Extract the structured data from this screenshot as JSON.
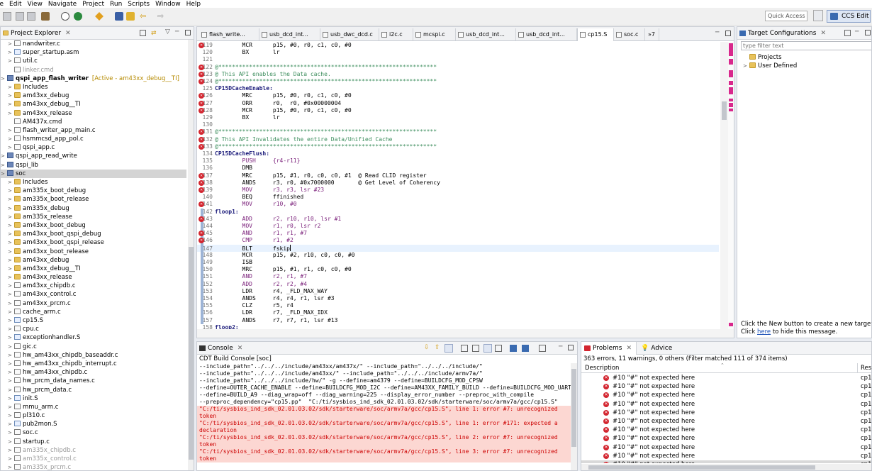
{
  "menu": [
    "le",
    "Edit",
    "View",
    "Navigate",
    "Project",
    "Run",
    "Scripts",
    "Window",
    "Help"
  ],
  "toolbar": {
    "quick_access": "Quick Access",
    "perspective": "CCS Edit"
  },
  "project_explorer": {
    "title": "Project Explorer",
    "items": [
      {
        "label": "nandwriter.c",
        "icon": "c-file-icon",
        "indent": 1,
        "arrow": true
      },
      {
        "label": "super_startup.asm",
        "icon": "asm-file-icon",
        "indent": 1,
        "arrow": true
      },
      {
        "label": "util.c",
        "icon": "c-file-icon",
        "indent": 1,
        "arrow": true
      },
      {
        "label": "linker.cmd",
        "icon": "cmd-file-icon",
        "indent": 1,
        "arrow": false,
        "dim": true
      },
      {
        "label": "qspi_app_flash_writer",
        "suffix": "[Active - am43xx_debug__TI]",
        "icon": "project-icon",
        "indent": 0,
        "arrow": true,
        "bold": true
      },
      {
        "label": "Includes",
        "icon": "folder-icon",
        "indent": 1,
        "arrow": true
      },
      {
        "label": "am43xx_debug",
        "icon": "folder-icon",
        "indent": 1,
        "arrow": true
      },
      {
        "label": "am43xx_debug__TI",
        "icon": "folder-icon",
        "indent": 1,
        "arrow": true
      },
      {
        "label": "am43xx_release",
        "icon": "folder-icon",
        "indent": 1,
        "arrow": true
      },
      {
        "label": "AM437x.cmd",
        "icon": "cmd-file-icon",
        "indent": 1,
        "arrow": false
      },
      {
        "label": "flash_writer_app_main.c",
        "icon": "c-file-icon",
        "indent": 1,
        "arrow": true
      },
      {
        "label": "hsmmcsd_app_pol.c",
        "icon": "c-file-icon",
        "indent": 1,
        "arrow": true
      },
      {
        "label": "qspi_app.c",
        "icon": "c-file-icon",
        "indent": 1,
        "arrow": true
      },
      {
        "label": "qspi_app_read_write",
        "icon": "project-icon",
        "indent": 0,
        "arrow": true
      },
      {
        "label": "qspi_lib",
        "icon": "project-icon",
        "indent": 0,
        "arrow": true
      },
      {
        "label": "soc",
        "icon": "project-icon",
        "indent": 0,
        "arrow": true,
        "selected": true
      },
      {
        "label": "Includes",
        "icon": "folder-icon",
        "indent": 1,
        "arrow": true
      },
      {
        "label": "am335x_boot_debug",
        "icon": "folder-icon",
        "indent": 1,
        "arrow": true
      },
      {
        "label": "am335x_boot_release",
        "icon": "folder-icon",
        "indent": 1,
        "arrow": true
      },
      {
        "label": "am335x_debug",
        "icon": "folder-icon",
        "indent": 1,
        "arrow": true
      },
      {
        "label": "am335x_release",
        "icon": "folder-icon",
        "indent": 1,
        "arrow": true
      },
      {
        "label": "am43xx_boot_debug",
        "icon": "folder-icon",
        "indent": 1,
        "arrow": true
      },
      {
        "label": "am43xx_boot_qspi_debug",
        "icon": "folder-icon",
        "indent": 1,
        "arrow": true
      },
      {
        "label": "am43xx_boot_qspi_release",
        "icon": "folder-icon",
        "indent": 1,
        "arrow": true
      },
      {
        "label": "am43xx_boot_release",
        "icon": "folder-icon",
        "indent": 1,
        "arrow": true
      },
      {
        "label": "am43xx_debug",
        "icon": "folder-icon",
        "indent": 1,
        "arrow": true
      },
      {
        "label": "am43xx_debug__TI",
        "icon": "folder-icon",
        "indent": 1,
        "arrow": true
      },
      {
        "label": "am43xx_release",
        "icon": "folder-icon",
        "indent": 1,
        "arrow": true
      },
      {
        "label": "am43xx_chipdb.c",
        "icon": "c-file-icon",
        "indent": 1,
        "arrow": true
      },
      {
        "label": "am43xx_control.c",
        "icon": "c-file-icon",
        "indent": 1,
        "arrow": true
      },
      {
        "label": "am43xx_prcm.c",
        "icon": "c-file-icon",
        "indent": 1,
        "arrow": true
      },
      {
        "label": "cache_arm.c",
        "icon": "c-file-icon",
        "indent": 1,
        "arrow": true
      },
      {
        "label": "cp15.S",
        "icon": "asm-file-icon",
        "indent": 1,
        "arrow": true
      },
      {
        "label": "cpu.c",
        "icon": "c-file-icon",
        "indent": 1,
        "arrow": true
      },
      {
        "label": "exceptionhandler.S",
        "icon": "asm-file-icon",
        "indent": 1,
        "arrow": true
      },
      {
        "label": "gic.c",
        "icon": "c-file-icon",
        "indent": 1,
        "arrow": true
      },
      {
        "label": "hw_am43xx_chipdb_baseaddr.c",
        "icon": "c-file-icon",
        "indent": 1,
        "arrow": true
      },
      {
        "label": "hw_am43xx_chipdb_interrupt.c",
        "icon": "c-file-icon",
        "indent": 1,
        "arrow": true
      },
      {
        "label": "hw_am43xx_chipdb.c",
        "icon": "c-file-icon",
        "indent": 1,
        "arrow": true
      },
      {
        "label": "hw_prcm_data_names.c",
        "icon": "c-file-icon",
        "indent": 1,
        "arrow": true
      },
      {
        "label": "hw_prcm_data.c",
        "icon": "c-file-icon",
        "indent": 1,
        "arrow": true
      },
      {
        "label": "init.S",
        "icon": "asm-file-icon",
        "indent": 1,
        "arrow": true
      },
      {
        "label": "mmu_arm.c",
        "icon": "c-file-icon",
        "indent": 1,
        "arrow": true
      },
      {
        "label": "pl310.c",
        "icon": "c-file-icon",
        "indent": 1,
        "arrow": true
      },
      {
        "label": "pub2mon.S",
        "icon": "asm-file-icon",
        "indent": 1,
        "arrow": true
      },
      {
        "label": "soc.c",
        "icon": "c-file-icon",
        "indent": 1,
        "arrow": true
      },
      {
        "label": "startup.c",
        "icon": "c-file-icon",
        "indent": 1,
        "arrow": true
      },
      {
        "label": "am335x_chipdb.c",
        "icon": "c-file-icon",
        "indent": 1,
        "arrow": true,
        "dim": true
      },
      {
        "label": "am335x_control.c",
        "icon": "c-file-icon",
        "indent": 1,
        "arrow": true,
        "dim": true
      },
      {
        "label": "am335x_prcm.c",
        "icon": "c-file-icon",
        "indent": 1,
        "arrow": true,
        "dim": true
      }
    ]
  },
  "editor": {
    "tabs": [
      "flash_write...",
      "usb_dcd_int...",
      "usb_dwc_dcd.c",
      "i2c.c",
      "mcspi.c",
      "usb_dcd_int...",
      "usb_dcd_int...",
      "cp15.S",
      "soc.c",
      "»7"
    ],
    "active_tab": 7,
    "lines": [
      {
        "n": "119",
        "err": true,
        "text": "        MCR      p15, #0, r0, c1, c0, #0"
      },
      {
        "n": "120",
        "err": false,
        "text": "        BX       lr"
      },
      {
        "n": "121",
        "err": false,
        "text": ""
      },
      {
        "n": "122",
        "err": true,
        "text": "@****************************************************************",
        "cm": true
      },
      {
        "n": "123",
        "err": true,
        "text": "@ This API enables the Data cache.",
        "cm": true
      },
      {
        "n": "124",
        "err": true,
        "text": "@****************************************************************",
        "cm": true
      },
      {
        "n": "125",
        "err": false,
        "text": "CP15DCacheEnable:",
        "label": true
      },
      {
        "n": "126",
        "err": true,
        "text": "        MRC      p15, #0, r0, c1, c0, #0"
      },
      {
        "n": "127",
        "err": true,
        "text": "        ORR      r0,  r0, #0x00000004"
      },
      {
        "n": "128",
        "err": true,
        "text": "        MCR      p15, #0, r0, c1, c0, #0"
      },
      {
        "n": "129",
        "err": false,
        "text": "        BX       lr"
      },
      {
        "n": "130",
        "err": false,
        "text": ""
      },
      {
        "n": "131",
        "err": true,
        "text": "@****************************************************************",
        "cm": true
      },
      {
        "n": "132",
        "err": true,
        "text": "@ This API Invalidates the entire Data/Unified Cache",
        "cm": true
      },
      {
        "n": "133",
        "err": true,
        "text": "@****************************************************************",
        "cm": true
      },
      {
        "n": "134",
        "err": false,
        "text": "CP15DCacheFlush:",
        "label": true
      },
      {
        "n": "135",
        "err": false,
        "text": "        PUSH     {r4-r11}",
        "kw": true
      },
      {
        "n": "136",
        "err": false,
        "text": "        DMB"
      },
      {
        "n": "137",
        "err": true,
        "text": "        MRC      p15, #1, r0, c0, c0, #1  @ Read CLID register"
      },
      {
        "n": "138",
        "err": true,
        "text": "        ANDS     r3, r0, #0x7000000       @ Get Level of Coherency"
      },
      {
        "n": "139",
        "err": true,
        "text": "        MOV      r3, r3, lsr #23",
        "kw": true
      },
      {
        "n": "140",
        "err": false,
        "text": "        BEQ      ffinished"
      },
      {
        "n": "141",
        "err": true,
        "text": "        MOV      r10, #0",
        "kw": true
      },
      {
        "n": "142",
        "err": false,
        "text": "floop1:",
        "label": true
      },
      {
        "n": "143",
        "err": true,
        "text": "        ADD      r2, r10, r10, lsr #1",
        "kw": true
      },
      {
        "n": "144",
        "err": false,
        "text": "        MOV      r1, r0, lsr r2",
        "kw": true
      },
      {
        "n": "145",
        "err": true,
        "text": "        AND      r1, r1, #7",
        "kw": true
      },
      {
        "n": "146",
        "err": true,
        "text": "        CMP      r1, #2",
        "kw": true
      },
      {
        "n": "147",
        "err": false,
        "text": "        BLT      fskip",
        "cur": true
      },
      {
        "n": "148",
        "err": false,
        "text": "        MCR      p15, #2, r10, c0, c0, #0"
      },
      {
        "n": "149",
        "err": false,
        "text": "        ISB"
      },
      {
        "n": "150",
        "err": false,
        "text": "        MRC      p15, #1, r1, c0, c0, #0"
      },
      {
        "n": "151",
        "err": false,
        "text": "        AND      r2, r1, #7",
        "kw": true
      },
      {
        "n": "152",
        "err": false,
        "text": "        ADD      r2, r2, #4",
        "kw": true
      },
      {
        "n": "153",
        "err": false,
        "text": "        LDR      r4, _FLD_MAX_WAY"
      },
      {
        "n": "154",
        "err": false,
        "text": "        ANDS     r4, r4, r1, lsr #3"
      },
      {
        "n": "155",
        "err": false,
        "text": "        CLZ      r5, r4"
      },
      {
        "n": "156",
        "err": false,
        "text": "        LDR      r7, _FLD_MAX_IDX"
      },
      {
        "n": "157",
        "err": false,
        "text": "        ANDS     r7, r7, r1, lsr #13"
      },
      {
        "n": "158",
        "err": false,
        "text": "floop2:",
        "label": true
      }
    ]
  },
  "target_config": {
    "title": "Target Configurations",
    "filter_placeholder": "type filter text",
    "items": [
      "Projects",
      "User Defined"
    ],
    "message": "Click the New button to create a new target configu",
    "hide_prefix": "Click ",
    "hide_link": "here",
    "hide_suffix": " to hide this message."
  },
  "console": {
    "title": "Console",
    "subtitle": "CDT Build Console [soc]",
    "lines": [
      {
        "t": "--include_path=\"../../../include/am43xx/am437x/\" --include_path=\"../../../include/\"",
        "e": false
      },
      {
        "t": "--include_path=\"../../../include/am43xx/\" --include_path=\"../../../include/armv7a/\"",
        "e": false
      },
      {
        "t": "--include_path=\"../../../include/hw/\" -g --define=am4379 --define=BUILDCFG_MOD_CPSW",
        "e": false
      },
      {
        "t": "--define=OUTER_CACHE_ENABLE --define=BUILDCFG_MOD_I2C --define=AM43XX_FAMILY_BUILD --define=BUILDCFG_MOD_UART",
        "e": false
      },
      {
        "t": "--define=BUILD_A9 --diag_wrap=off --diag_warning=225 --display_error_number --preproc_with_compile",
        "e": false
      },
      {
        "t": "--preproc_dependency=\"cp15.pp\"  \"C:/ti/sysbios_ind_sdk_02.01.03.02/sdk/starterware/soc/armv7a/gcc/cp15.S\"",
        "e": false
      },
      {
        "t": "\"C:/ti/sysbios_ind_sdk_02.01.03.02/sdk/starterware/soc/armv7a/gcc/cp15.S\", line 1: error #7: unrecognized",
        "e": true
      },
      {
        "t": "token",
        "e": true
      },
      {
        "t": "\"C:/ti/sysbios_ind_sdk_02.01.03.02/sdk/starterware/soc/armv7a/gcc/cp15.S\", line 1: error #171: expected a",
        "e": false
      },
      {
        "t": "declaration",
        "e": false
      },
      {
        "t": "\"C:/ti/sysbios_ind_sdk_02.01.03.02/sdk/starterware/soc/armv7a/gcc/cp15.S\", line 2: error #7: unrecognized",
        "e": false
      },
      {
        "t": "token",
        "e": false
      },
      {
        "t": "\"C:/ti/sysbios_ind_sdk_02.01.03.02/sdk/starterware/soc/armv7a/gcc/cp15.S\", line 3: error #7: unrecognized",
        "e": false
      },
      {
        "t": "token",
        "e": false
      }
    ]
  },
  "problems": {
    "tab_problems": "Problems",
    "tab_advice": "Advice",
    "summary": "363 errors, 11 warnings, 0 others (Filter matched 111 of 374 items)",
    "col_description": "Description",
    "col_resource": "Reso",
    "rows": [
      {
        "d": "#10 \"#\" not expected here",
        "r": "cp15"
      },
      {
        "d": "#10 \"#\" not expected here",
        "r": "cp15"
      },
      {
        "d": "#10 \"#\" not expected here",
        "r": "cp15"
      },
      {
        "d": "#10 \"#\" not expected here",
        "r": "cp15"
      },
      {
        "d": "#10 \"#\" not expected here",
        "r": "cp15"
      },
      {
        "d": "#10 \"#\" not expected here",
        "r": "cp15"
      },
      {
        "d": "#10 \"#\" not expected here",
        "r": "cp15"
      },
      {
        "d": "#10 \"#\" not expected here",
        "r": "cp15"
      },
      {
        "d": "#10 \"#\" not expected here",
        "r": "cp15"
      },
      {
        "d": "#10 \"#\" not expected here",
        "r": "cp15"
      },
      {
        "d": "#10 \"#\" not expected here",
        "r": "cp15"
      },
      {
        "d": "#10 \"#\" not expected here",
        "r": "cp15"
      }
    ],
    "selected_row": 10
  },
  "colors": {
    "accent": "#3875d7",
    "error": "#d3252f",
    "console_err_bg": "#fcd7d2",
    "keyword": "#8a1a8a",
    "comment": "#3f8f5f"
  }
}
